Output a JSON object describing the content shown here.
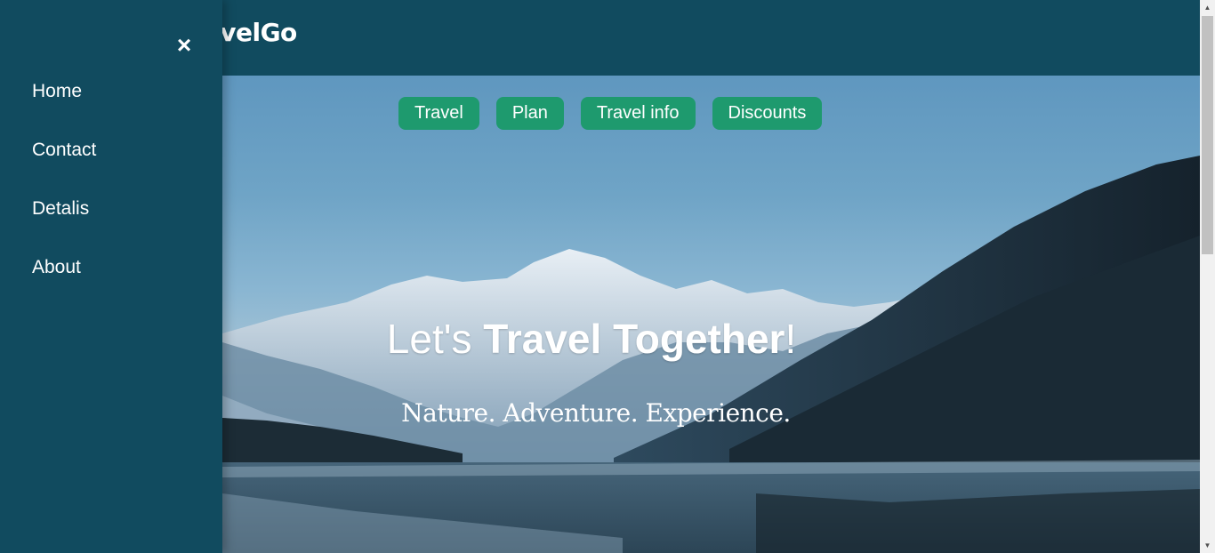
{
  "brand": {
    "logo_text": "TravelGo"
  },
  "sidenav": {
    "close_symbol": "×",
    "items": [
      {
        "label": "Home"
      },
      {
        "label": "Contact"
      },
      {
        "label": "Detalis"
      },
      {
        "label": "About"
      }
    ]
  },
  "hero": {
    "tabs": [
      {
        "label": "Travel"
      },
      {
        "label": "Plan"
      },
      {
        "label": "Travel info"
      },
      {
        "label": "Discounts"
      }
    ],
    "headline_prefix": "Let's ",
    "headline_bold": "Travel Together",
    "headline_suffix": "!",
    "tagline": "Nature. Adventure. Experience."
  },
  "colors": {
    "nav_bg": "#114b5f",
    "button_bg": "#1e9a6e",
    "text": "#ffffff"
  },
  "scrollbar": {
    "up_icon": "arrow-up-icon",
    "down_icon": "arrow-down-icon"
  }
}
